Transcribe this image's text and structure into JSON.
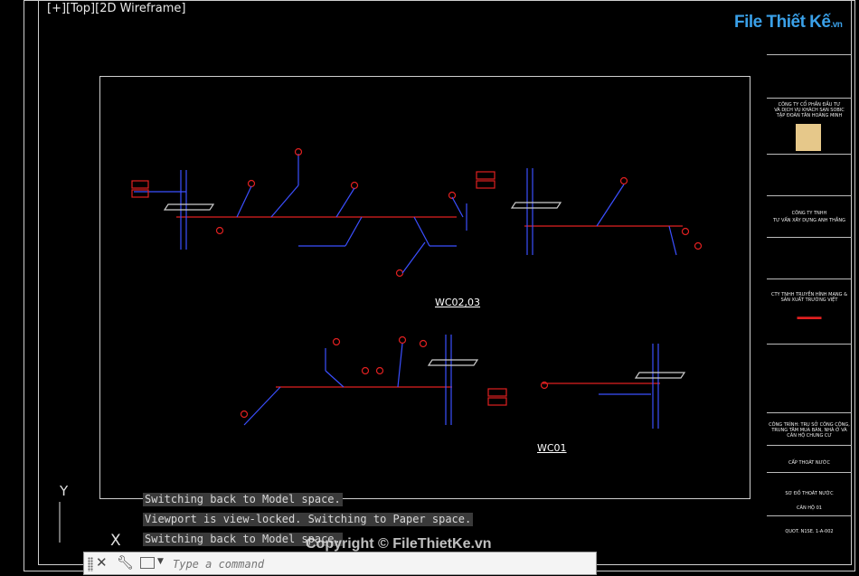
{
  "viewport": {
    "label": "[+][Top][2D Wireframe]"
  },
  "drawing": {
    "label_top": "WC02,03",
    "label_bottom": "WC01"
  },
  "logo": {
    "name": "File Thiết Kế",
    "suffix": ".vn"
  },
  "ucs": {
    "y_axis": "Y",
    "x_axis": "X"
  },
  "command_history": [
    "Switching back to Model space.",
    "Viewport is view-locked. Switching to Paper space.",
    "Switching back to Model space."
  ],
  "command_bar": {
    "placeholder": "Type a command"
  },
  "watermark": "Copyright © FileThietKe.vn",
  "title_block": {
    "company_lines": [
      "CÔNG TY CỔ PHẦN ĐẦU TƯ",
      "VÀ DỊCH VỤ KHÁCH SẠN SOBIC",
      "TẬP ĐOÀN TÂN HOÀNG MINH"
    ],
    "consultant_lines": [
      "CÔNG TY TNHH",
      "TƯ VẤN XÂY DỰNG ANH THẮNG"
    ],
    "partner_lines": [
      "CTY TNHH TRUYỀN HÌNH MẠNG & ",
      "SẢN XUẤT TRƯỜNG VIỆT"
    ],
    "project_lines": [
      "CÔNG TRÌNH: TRỤ SỞ CÔNG CỘNG,",
      "TRUNG TÂM MUA BÁN, NHÀ Ở VÀ",
      "CĂN HỘ CHUNG CƯ"
    ],
    "category": "CẤP THOÁT NƯỚC",
    "drawing_title": "SƠ ĐỒ THOÁT NƯỚC",
    "drawing_sub": "CĂN HỘ 01",
    "drawing_no": "QUOT. N1SE. 1-A-002"
  },
  "colors": {
    "pipe_red": "#e02020",
    "pipe_blue": "#3b4fff",
    "label_bg": "#e02020",
    "frame": "#cfcfcf"
  }
}
